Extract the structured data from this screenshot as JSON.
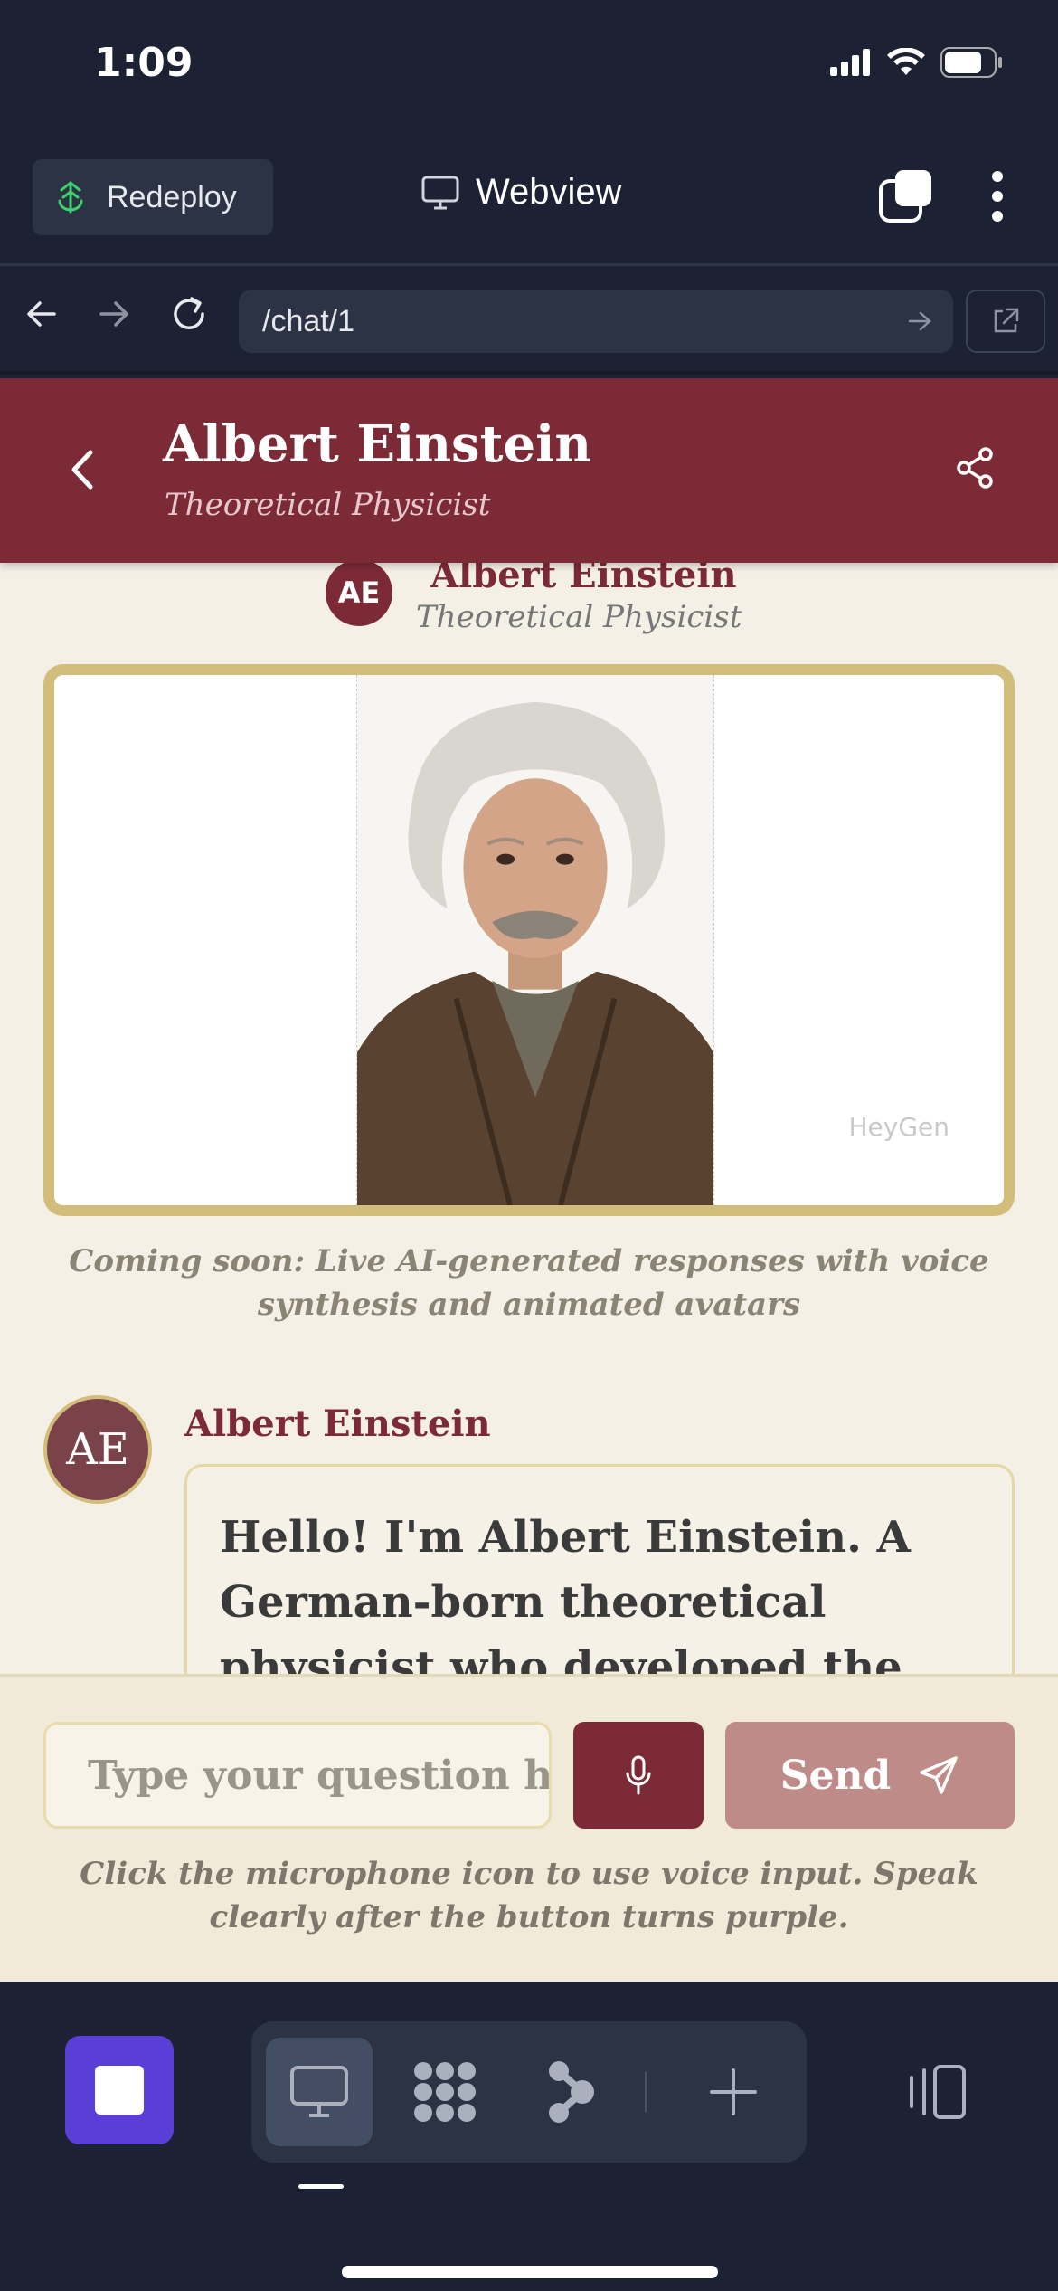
{
  "status": {
    "time": "1:09"
  },
  "toolbar": {
    "redeploy_label": "Redeploy",
    "webview_label": "Webview"
  },
  "urlbar": {
    "url": "/chat/1"
  },
  "header": {
    "name": "Albert Einstein",
    "role": "Theoretical Physicist"
  },
  "profile": {
    "initials": "AE",
    "name": "Albert Einstein",
    "role": "Theoretical Physicist"
  },
  "video": {
    "watermark": "HeyGen"
  },
  "notice": "Coming soon: Live AI-generated responses with voice synthesis and animated avatars",
  "message": {
    "initials": "AE",
    "author": "Albert Einstein",
    "text": "Hello! I'm Albert Einstein. A German-born theoretical physicist who developed the theory of"
  },
  "composer": {
    "placeholder": "Type your question here...",
    "send_label": "Send",
    "hint": "Click the microphone icon to use voice input. Speak clearly after the button turns purple."
  },
  "colors": {
    "brand": "#7d2a37",
    "gold": "#d3bd7b",
    "stop": "#5a3fd6"
  },
  "icons": [
    "back-arrow-icon",
    "forward-arrow-icon",
    "reload-icon",
    "share-icon",
    "mic-icon",
    "send-icon",
    "monitor-icon",
    "grid-icon",
    "nodes-icon",
    "plus-icon",
    "panel-icon"
  ]
}
